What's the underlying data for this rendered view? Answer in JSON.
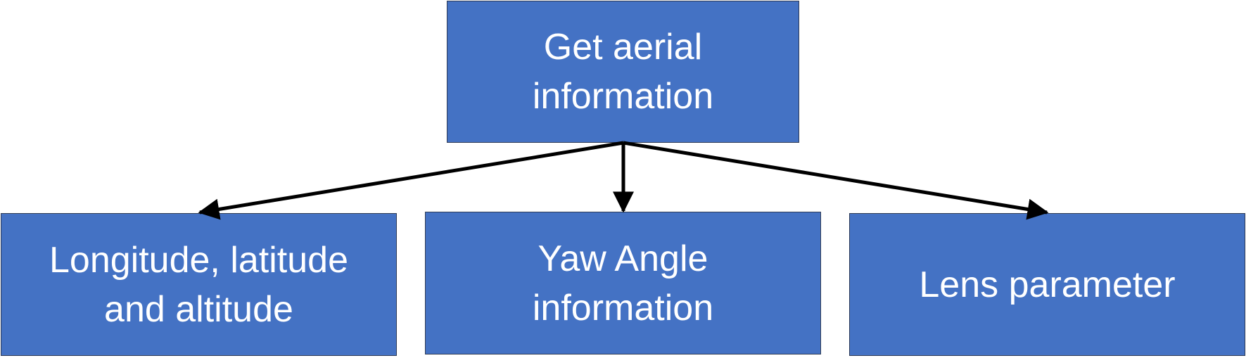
{
  "nodes": {
    "root": {
      "label": "Get aerial\ninformation"
    },
    "left": {
      "label": "Longitude, latitude\nand altitude"
    },
    "middle": {
      "label": "Yaw Angle\ninformation"
    },
    "right": {
      "label": "Lens parameter"
    }
  },
  "colors": {
    "node_fill": "#4472C4",
    "node_border": "#2F3B55",
    "node_text": "#FFFFFF",
    "arrow": "#000000"
  }
}
